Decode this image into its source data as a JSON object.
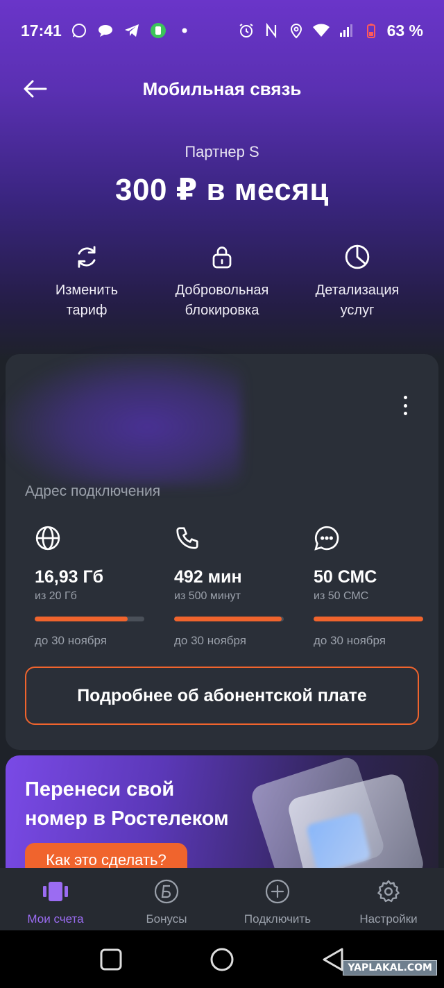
{
  "status_bar": {
    "time": "17:41",
    "battery": "63 %",
    "left_icons": [
      "whatsapp-icon",
      "chat-icon",
      "telegram-icon",
      "app-icon",
      "dot-icon"
    ],
    "right_icons": [
      "alarm-icon",
      "nfc-icon",
      "location-icon",
      "wifi-icon",
      "signal-icon",
      "battery-icon"
    ]
  },
  "header": {
    "title": "Мобильная связь"
  },
  "tariff": {
    "name": "Партнер S",
    "price": "300 ₽ в месяц"
  },
  "actions": [
    {
      "label1": "Изменить",
      "label2": "тариф",
      "icon": "refresh-icon"
    },
    {
      "label1": "Добровольная",
      "label2": "блокировка",
      "icon": "lock-icon"
    },
    {
      "label1": "Детализация",
      "label2": "услуг",
      "icon": "pie-chart-icon"
    }
  ],
  "card": {
    "address_label": "Адрес подключения",
    "counters": [
      {
        "icon": "globe-icon",
        "value": "16,93 Гб",
        "total": "из 20 Гб",
        "fraction": 0.8465,
        "until": "до 30 ноября"
      },
      {
        "icon": "phone-icon",
        "value": "492 мин",
        "total": "из 500 минут",
        "fraction": 0.984,
        "until": "до 30 ноября"
      },
      {
        "icon": "message-icon",
        "value": "50 СМС",
        "total": "из 50 СМС",
        "fraction": 1.0,
        "until": "до 30 ноября"
      }
    ],
    "details_button": "Подробнее об абонентской плате"
  },
  "promo": {
    "title_line1": "Перенеси свой",
    "title_line2": "номер в Ростелеком",
    "button": "Как это сделать?"
  },
  "bottom_nav": [
    {
      "label": "Мои счета",
      "icon": "accounts-icon",
      "active": true
    },
    {
      "label": "Бонусы",
      "icon": "bonus-icon",
      "active": false
    },
    {
      "label": "Подключить",
      "icon": "plus-circle-icon",
      "active": false
    },
    {
      "label": "Настройки",
      "icon": "settings-icon",
      "active": false
    }
  ],
  "colors": {
    "accent": "#f0642d",
    "active_nav": "#9b6cf2",
    "header_purple": "#6a35c9"
  },
  "watermark": "YAPLAKAL.COM"
}
